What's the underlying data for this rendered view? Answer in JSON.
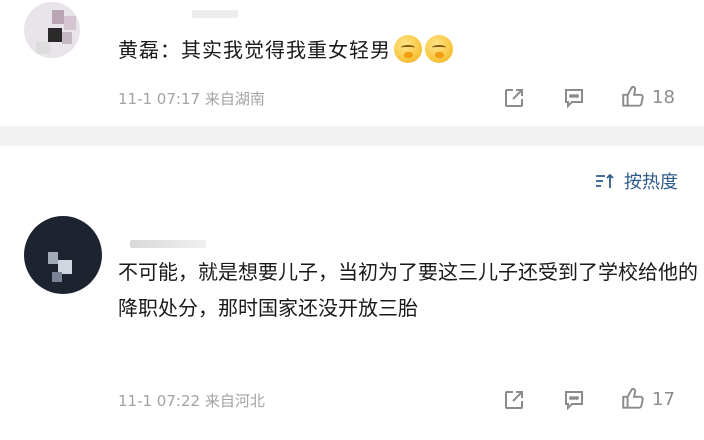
{
  "comments": [
    {
      "name": "黄磊",
      "separator": "：",
      "text": "其实我觉得我重女轻男",
      "time": "11-1 07:17",
      "location": "来自湖南",
      "likes": "18",
      "emojis": [
        "smirk-emoji",
        "smirk-emoji"
      ]
    },
    {
      "text": "不可能，就是想要儿子，当初为了要这三儿子还受到了学校给他的降职处分，那时国家还没开放三胎",
      "time": "11-1 07:22",
      "location": "来自河北",
      "likes": "17"
    }
  ],
  "sort": {
    "label": "按热度",
    "icon": "sort-icon"
  },
  "icons": {
    "share": "share-icon",
    "reply": "comment-icon",
    "like": "thumbs-up-icon"
  },
  "colors": {
    "accent": "#2e5a8c",
    "meta": "#a3a3a3",
    "separator": "#f2f2f2"
  }
}
